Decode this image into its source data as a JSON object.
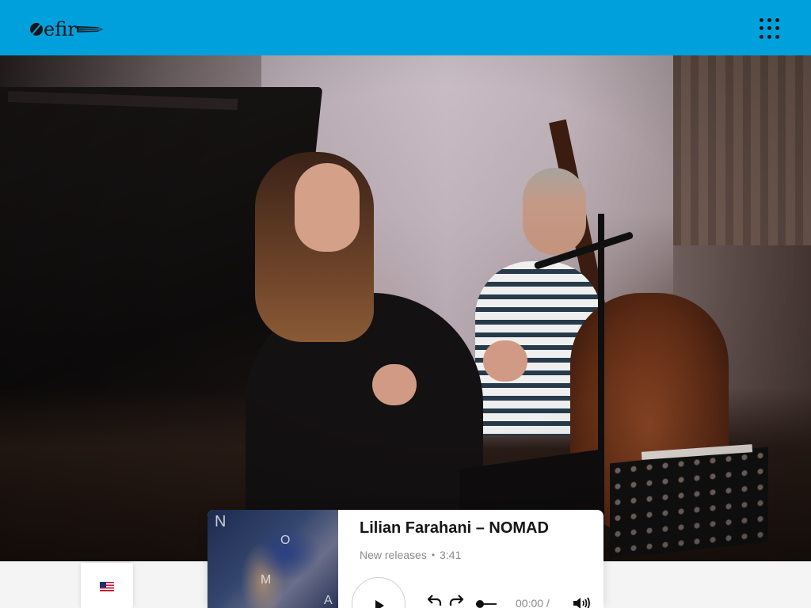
{
  "header": {
    "logo_text": "efir",
    "logo_icon": "efir-logo-icon",
    "menu_icon": "grid-menu-icon",
    "background_color": "#00a0dd"
  },
  "hero": {
    "image": "photo of singer performing with double bassist in a studio"
  },
  "language": {
    "flag_icon": "us-flag-icon"
  },
  "player": {
    "title": "Lilian Farahani – NOMAD",
    "category": "New releases",
    "separator": "•",
    "duration": "3:41",
    "current_time": "00:00 /",
    "cover_letters": [
      "N",
      "O",
      "M",
      "A"
    ],
    "icons": {
      "play": "play-icon",
      "rewind": "undo-arrow-icon",
      "forward": "redo-arrow-icon",
      "volume": "volume-icon"
    },
    "progress": 0
  }
}
